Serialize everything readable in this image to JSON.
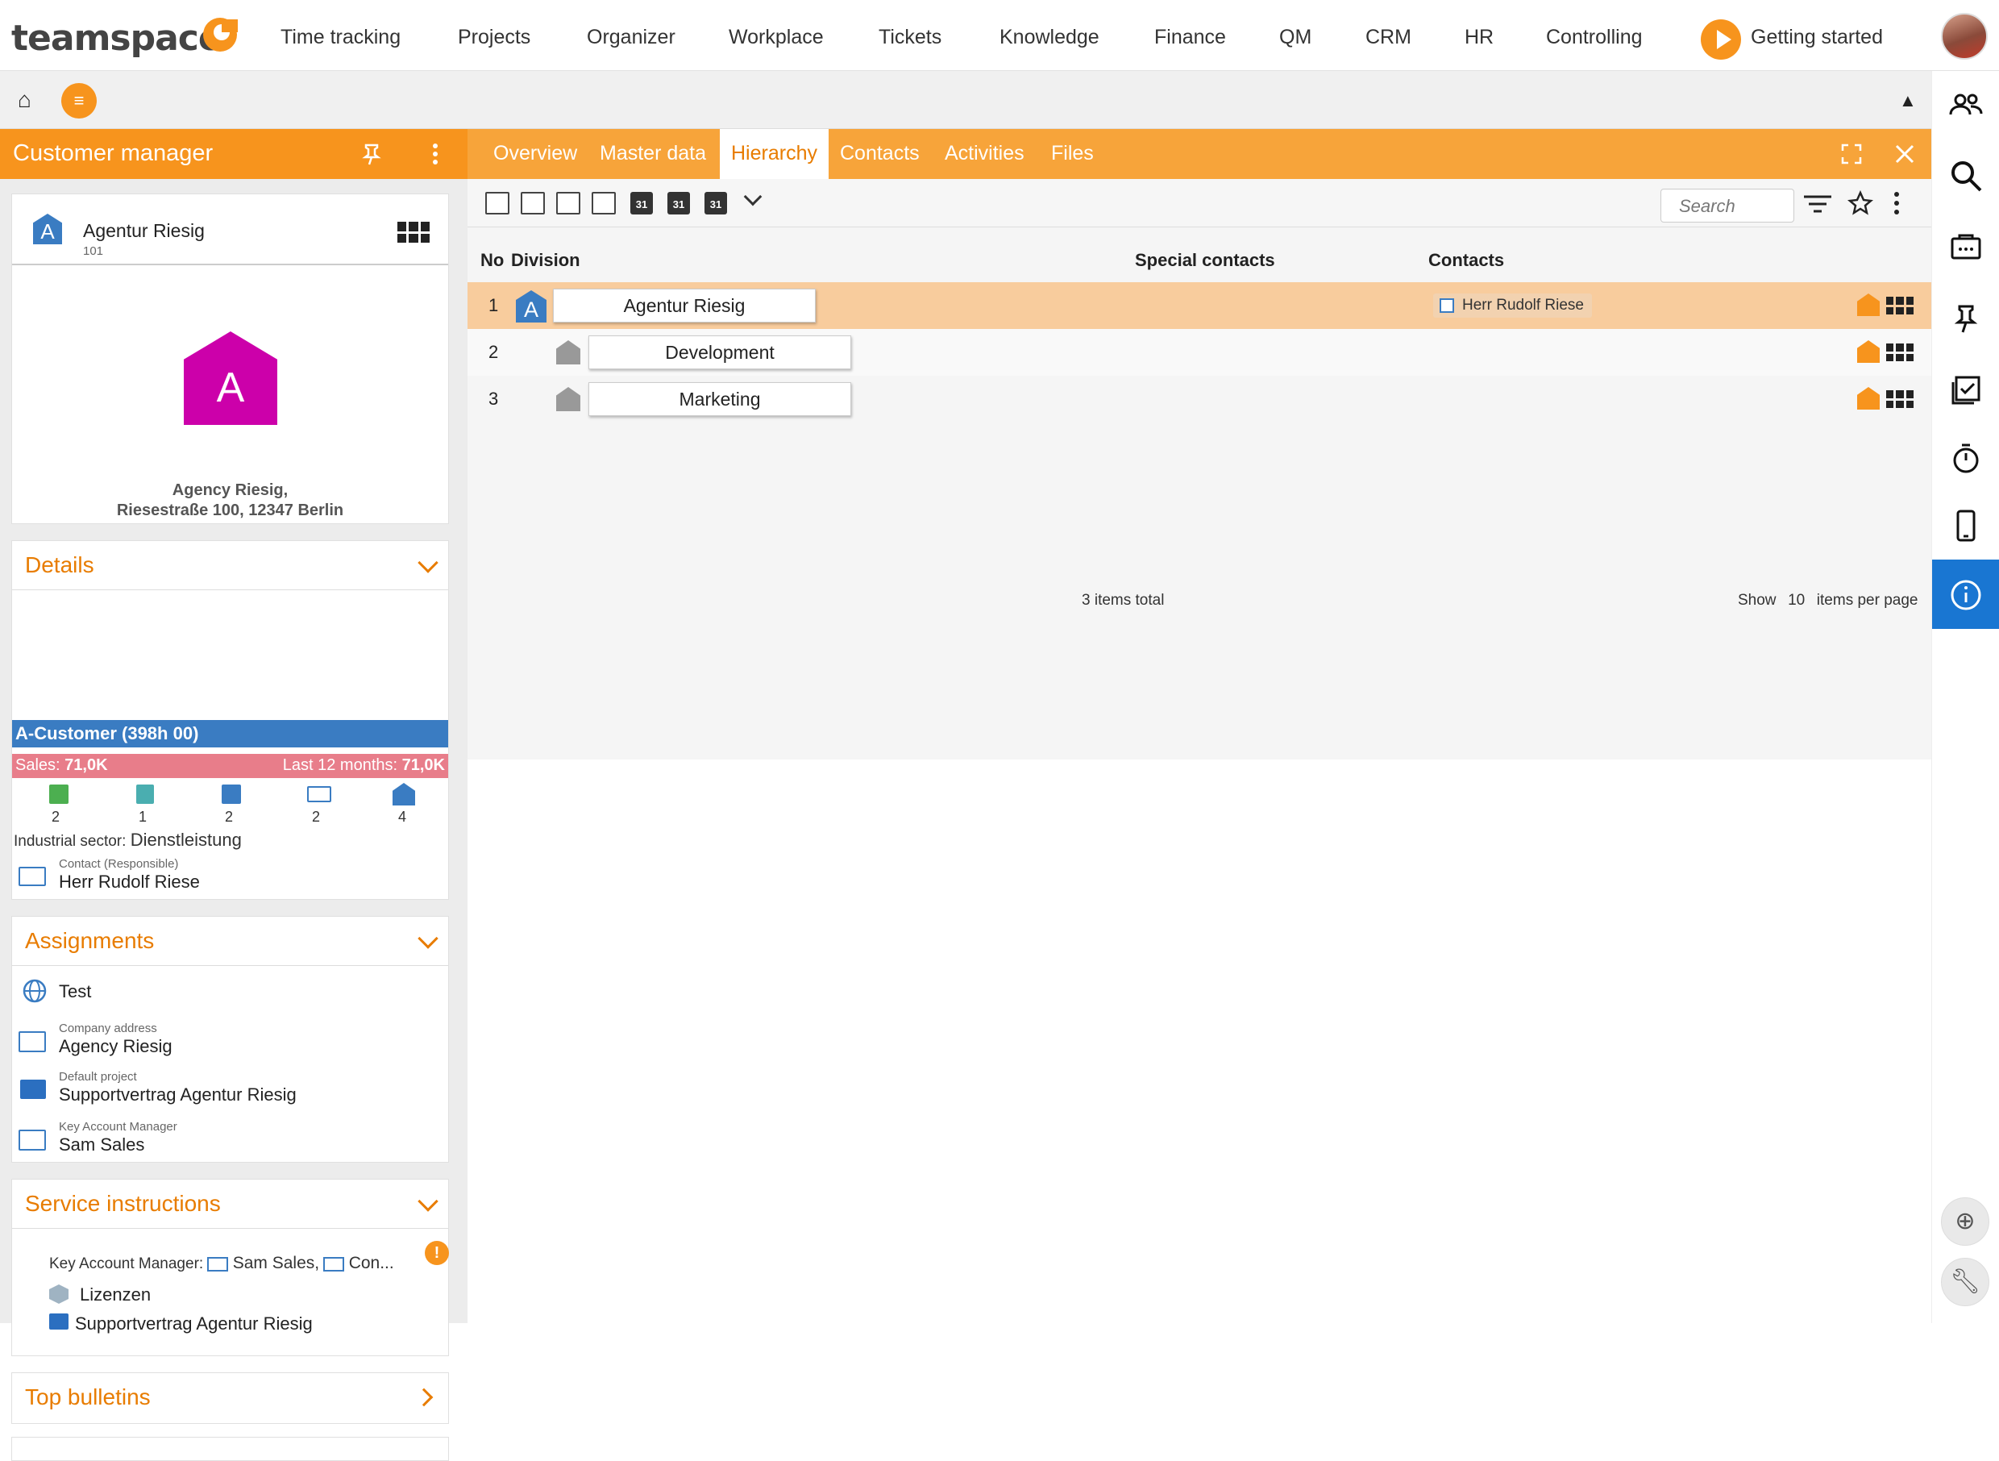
{
  "topnav": {
    "logo": "teamspace",
    "items": [
      "Time tracking",
      "Projects",
      "Organizer",
      "Workplace",
      "Tickets",
      "Knowledge",
      "Finance",
      "QM",
      "CRM",
      "HR",
      "Controlling"
    ],
    "getting_started": "Getting started"
  },
  "panel": {
    "title": "Customer manager",
    "company": {
      "name": "Agentur Riesig",
      "number": "101",
      "logo_letter": "A",
      "address_line1": "Agency Riesig,",
      "address_line2": "Riesestraße 100, 12347 Berlin"
    },
    "details": {
      "title": "Details",
      "category": "A-Customer (398h 00)",
      "sales_label": "Sales:",
      "sales_value": "71,0K",
      "last12_label": "Last 12 months:",
      "last12_value": "71,0K",
      "counts": [
        "2",
        "1",
        "2",
        "2",
        "4"
      ],
      "industrial_label": "Industrial sector:",
      "industrial_value": "Dienstleistung",
      "contact_label": "Contact (Responsible)",
      "contact_value": "Herr Rudolf Riese"
    },
    "assignments": {
      "title": "Assignments",
      "items": [
        {
          "label": "",
          "value": "Test"
        },
        {
          "label": "Company address",
          "value": "Agency Riesig"
        },
        {
          "label": "Default project",
          "value": "Supportvertrag Agentur Riesig"
        },
        {
          "label": "Key Account Manager",
          "value": "Sam Sales"
        }
      ]
    },
    "service": {
      "title": "Service instructions",
      "kam_label": "Key Account Manager:",
      "kam_value1": "Sam Sales,",
      "kam_value2": "Con...",
      "item1": "Lizenzen",
      "item2": "Supportvertrag Agentur Riesig"
    },
    "bulletins": {
      "title": "Top bulletins"
    }
  },
  "tabs": [
    "Overview",
    "Master data",
    "Hierarchy",
    "Contacts",
    "Activities",
    "Files"
  ],
  "toolbar": {
    "search_placeholder": "Search",
    "cal_label": "31"
  },
  "table": {
    "headers": {
      "no": "No",
      "division": "Division",
      "special": "Special contacts",
      "contacts": "Contacts"
    },
    "rows": [
      {
        "no": "1",
        "name": "Agentur Riesig",
        "contact": "Herr Rudolf Riese"
      },
      {
        "no": "2",
        "name": "Development",
        "contact": ""
      },
      {
        "no": "3",
        "name": "Marketing",
        "contact": ""
      }
    ],
    "total": "3 items total",
    "show_label": "Show",
    "per_page": "10",
    "per_page_suffix": "items per page"
  }
}
